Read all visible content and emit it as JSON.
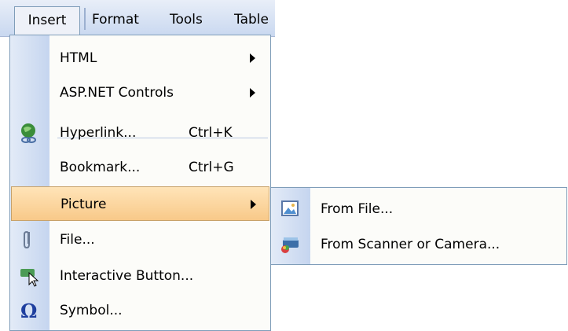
{
  "menubar": {
    "items": [
      {
        "label": "Insert"
      },
      {
        "label": "Format"
      },
      {
        "label": "Tools"
      },
      {
        "label": "Table"
      }
    ]
  },
  "insert_menu": {
    "items": [
      {
        "label": "HTML",
        "shortcut": "",
        "submenu": true,
        "icon": ""
      },
      {
        "label": "ASP.NET Controls",
        "shortcut": "",
        "submenu": true,
        "icon": ""
      },
      {
        "label": "Hyperlink...",
        "shortcut": "Ctrl+K",
        "submenu": false,
        "icon": "globe-link-icon"
      },
      {
        "label": "Bookmark...",
        "shortcut": "Ctrl+G",
        "submenu": false,
        "icon": ""
      },
      {
        "label": "Picture",
        "shortcut": "",
        "submenu": true,
        "icon": "",
        "highlighted": true
      },
      {
        "label": "File...",
        "shortcut": "",
        "submenu": false,
        "icon": "paperclip-icon"
      },
      {
        "label": "Interactive Button...",
        "shortcut": "",
        "submenu": false,
        "icon": "interactive-button-icon"
      },
      {
        "label": "Symbol...",
        "shortcut": "",
        "submenu": false,
        "icon": "omega-icon"
      }
    ]
  },
  "picture_submenu": {
    "items": [
      {
        "label": "From File...",
        "icon": "image-file-icon"
      },
      {
        "label": "From Scanner or Camera...",
        "icon": "scanner-icon"
      }
    ]
  },
  "colors": {
    "highlight": "#f8c989",
    "icon_column": "#c5d5ef",
    "border": "#7f9db9"
  }
}
